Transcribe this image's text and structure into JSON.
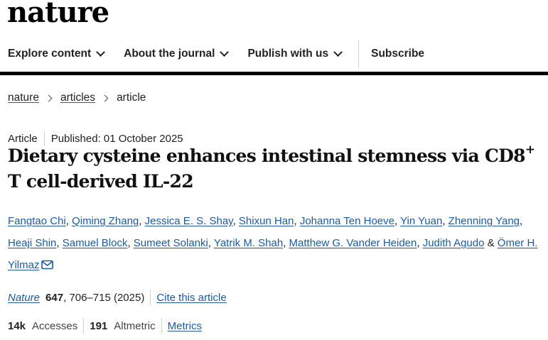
{
  "header": {
    "logo_text": "nature"
  },
  "nav": {
    "items": [
      {
        "label": "Explore content"
      },
      {
        "label": "About the journal"
      },
      {
        "label": "Publish with us"
      }
    ],
    "subscribe_label": "Subscribe"
  },
  "breadcrumb": {
    "items": [
      "nature",
      "articles",
      "article"
    ]
  },
  "article": {
    "type": "Article",
    "published": "Published: 01 October 2025",
    "title_main": "Dietary cysteine enhances intestinal stemness via CD8",
    "title_sup": "+",
    "title_rest": "T cell-derived IL-22",
    "authors": [
      "Fangtao Chi",
      "Qiming Zhang",
      "Jessica E. S. Shay",
      "Shixun Han",
      "Johanna Ten Hoeve",
      "Yin Yuan",
      "Zhenning Yang",
      "Heaji Shin",
      "Samuel Block",
      "Sumeet Solanki",
      "Yatrik M. Shah",
      "Matthew G. Vander Heiden",
      "Judith Agudo",
      "Ömer H. Yilmaz"
    ],
    "author_separator": ", ",
    "author_ampersand": " & ",
    "journal": "Nature",
    "volume": "647",
    "pages_year": ", 706–715 (2025)",
    "cite_label": "Cite this article"
  },
  "metrics": {
    "accesses_count": "14k",
    "accesses_label": "Accesses",
    "altmetric_count": "191",
    "altmetric_label": "Altmetric",
    "metrics_link": "Metrics"
  },
  "colors": {
    "link": "#1c5aa0",
    "rule": "#000000"
  }
}
